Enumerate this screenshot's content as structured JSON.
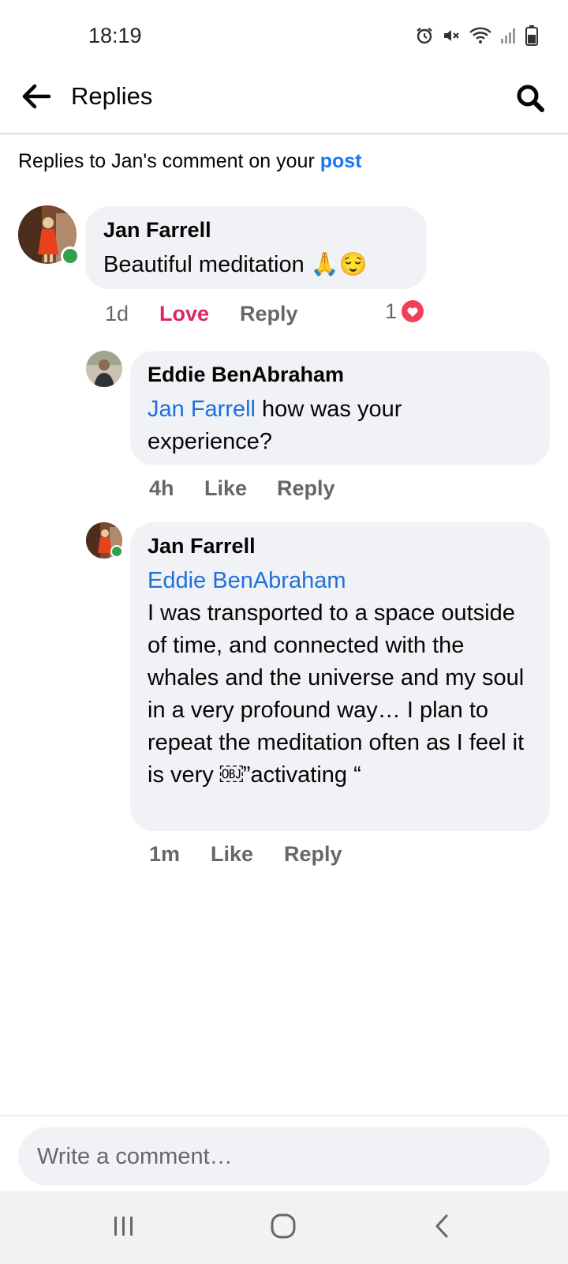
{
  "status_bar": {
    "time": "18:19"
  },
  "header": {
    "title": "Replies"
  },
  "context": {
    "prefix": "Replies to Jan's comment on your ",
    "link": "post"
  },
  "comments": [
    {
      "author": "Jan Farrell",
      "text": "Beautiful meditation 🙏😌",
      "time": "1d",
      "reaction_label": "Love",
      "reply_label": "Reply",
      "reaction_count": "1"
    },
    {
      "author": "Eddie BenAbraham",
      "mention": "Jan Farrell",
      "text": " how was your experience?",
      "time": "4h",
      "like_label": "Like",
      "reply_label": "Reply"
    },
    {
      "author": "Jan Farrell",
      "mention": "Eddie BenAbraham",
      "text": "I was transported to a space outside of time, and connected with the whales and the universe and my soul in a very profound way… I plan to repeat the meditation often as I feel it is very ￼”activating “",
      "time": "1m",
      "like_label": "Like",
      "reply_label": "Reply"
    }
  ],
  "composer": {
    "placeholder": "Write a comment…"
  },
  "colors": {
    "link_blue": "#1877f2",
    "mention_blue": "#216fdb",
    "love_red": "#e0245e",
    "online_green": "#31a24c",
    "bubble_gray": "#f0f2f5"
  },
  "icons": [
    "alarm-icon",
    "mute-icon",
    "wifi-icon",
    "signal-icon",
    "battery-icon",
    "back-arrow-icon",
    "search-icon",
    "heart-icon",
    "recents-icon",
    "home-icon",
    "nav-back-icon"
  ]
}
